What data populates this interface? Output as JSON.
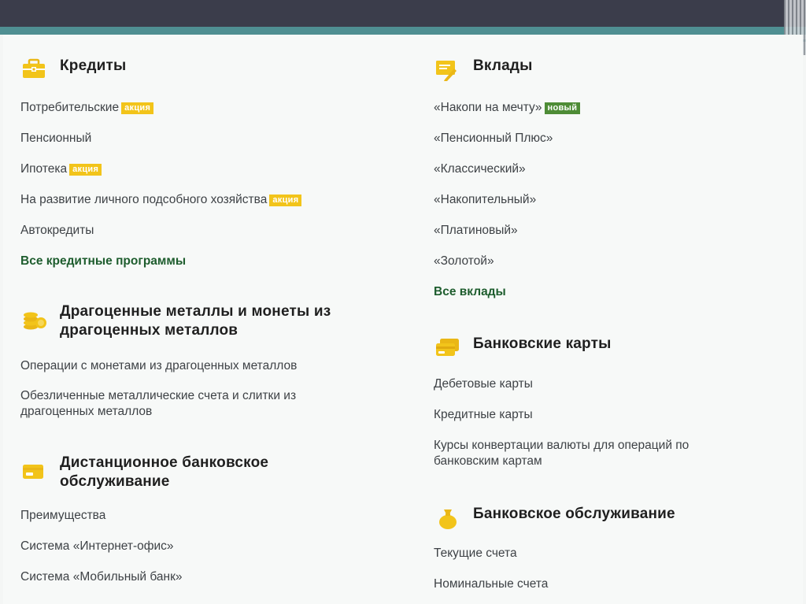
{
  "credits": {
    "title": "Кредиты",
    "icon": "briefcase-icon",
    "items": [
      {
        "label": "Потребительские",
        "badge": "акция"
      },
      {
        "label": "Пенсионный"
      },
      {
        "label": "Ипотека",
        "badge": "акция"
      },
      {
        "label": "На развитие личного подсобного хозяйства",
        "badge": "акция"
      },
      {
        "label": "Автокредиты"
      }
    ],
    "all_label": "Все кредитные программы"
  },
  "metals": {
    "title_line1": "Драгоценные металлы и монеты из",
    "title_line2": "драгоценных металлов",
    "icon": "coins-icon",
    "items": [
      "Операции с монетами из драгоценных металлов",
      "Обезличенные металлические счета и слитки из",
      "драгоценных металлов"
    ]
  },
  "remote": {
    "title_line1": "Дистанционное банковское",
    "title_line2": "обслуживание",
    "icon": "card-icon",
    "items": [
      "Преимущества",
      "Система «Интернет-офис»",
      "Система «Мобильный банк»"
    ]
  },
  "deposits": {
    "title": "Вклады",
    "icon": "document-pen-icon",
    "items": [
      {
        "label": "«Накопи на мечту»",
        "badge": "новый"
      },
      {
        "label": "«Пенсионный Плюс»"
      },
      {
        "label": "«Классический»"
      },
      {
        "label": "«Накопительный»"
      },
      {
        "label": "«Платиновый»"
      },
      {
        "label": "«Золотой»"
      }
    ],
    "all_label": "Все вклады"
  },
  "cards": {
    "title": "Банковские карты",
    "icon": "cards-icon",
    "items": [
      "Дебетовые карты",
      "Кредитные карты",
      "Курсы конвертации валюты для операций по",
      "банковским картам"
    ]
  },
  "service": {
    "title": "Банковское обслуживание",
    "icon": "money-bag-icon",
    "items": [
      "Текущие счета",
      "Номинальные счета"
    ]
  },
  "colors": {
    "accent": "#f2c41a",
    "link_all": "#1e5d2e",
    "badge_new": "#4e8c36",
    "topbar": "#3b3d4b",
    "teal": "#4f8f92"
  }
}
